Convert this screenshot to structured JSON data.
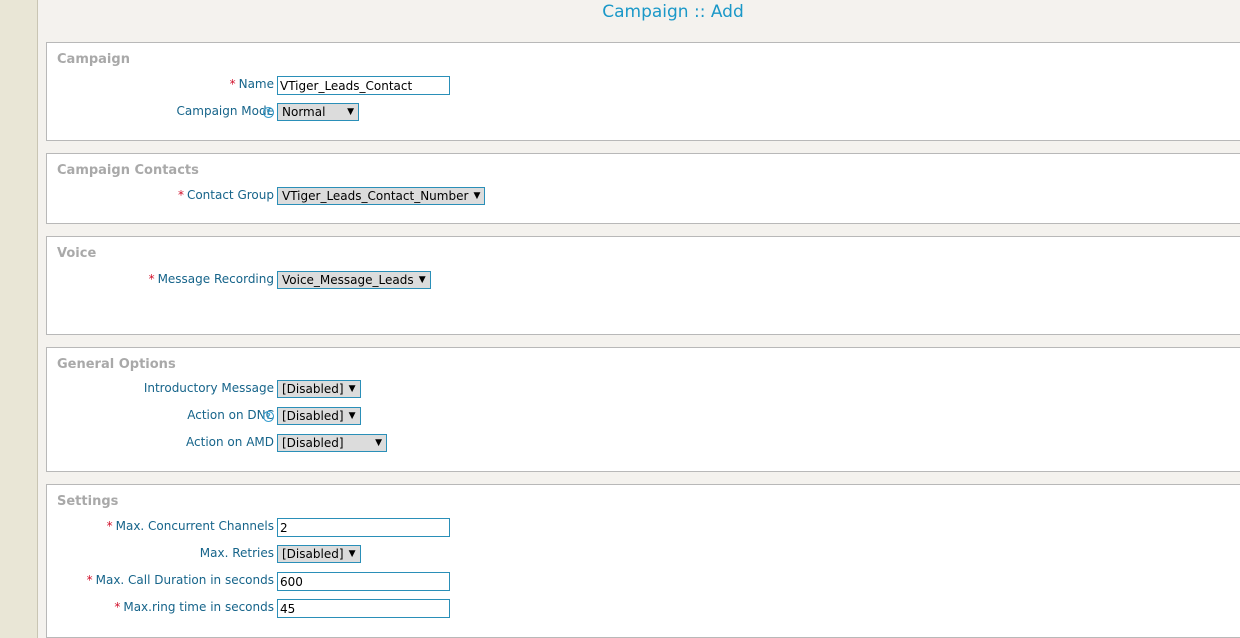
{
  "page": {
    "title": "Campaign :: Add"
  },
  "sections": {
    "campaign": {
      "title": "Campaign",
      "name": {
        "label": "Name",
        "value": "VTiger_Leads_Contact"
      },
      "mode": {
        "label": "Campaign Mode",
        "value": "Normal",
        "help_icon": "?"
      }
    },
    "contacts": {
      "title": "Campaign Contacts",
      "contact_group": {
        "label": "Contact Group",
        "value": "VTiger_Leads_Contact_Number"
      }
    },
    "voice": {
      "title": "Voice",
      "message_recording": {
        "label": "Message Recording",
        "value": "Voice_Message_Leads"
      }
    },
    "general": {
      "title": "General Options",
      "intro_message": {
        "label": "Introductory Message",
        "value": "[Disabled]"
      },
      "action_dnc": {
        "label": "Action on DNC",
        "value": "[Disabled]",
        "help_icon": "?"
      },
      "action_amd": {
        "label": "Action on AMD",
        "value": "[Disabled]"
      }
    },
    "settings": {
      "title": "Settings",
      "max_channels": {
        "label": "Max. Concurrent Channels",
        "value": "2"
      },
      "max_retries": {
        "label": "Max. Retries",
        "value": "[Disabled]"
      },
      "max_call_duration": {
        "label": "Max. Call Duration in seconds",
        "value": "600"
      },
      "max_ring_time": {
        "label": "Max.ring time in seconds",
        "value": "45"
      }
    }
  },
  "ui": {
    "required_marker": "*",
    "dropdown_caret": "▼"
  },
  "colors": {
    "label": "#16648a",
    "title": "#1a98c8",
    "required": "#d0102a",
    "section_title": "#a9a9a9"
  }
}
